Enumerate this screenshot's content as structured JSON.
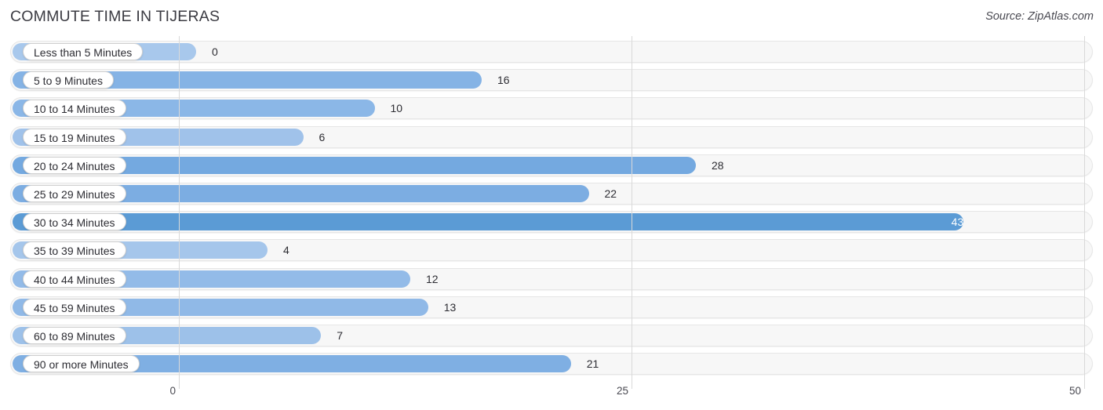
{
  "header": {
    "title": "COMMUTE TIME IN TIJERAS",
    "source": "Source: ZipAtlas.com"
  },
  "colors": {
    "bar_light": "#a8c8ec",
    "bar_mid": "#85b3e5",
    "bar_dark": "#5b9bd5",
    "track": "#f7f7f7",
    "gridline": "#d9d9d9",
    "text": "#2d2d33"
  },
  "chart_data": {
    "type": "bar",
    "orientation": "horizontal",
    "title": "COMMUTE TIME IN TIJERAS",
    "xlabel": "",
    "ylabel": "",
    "xlim": [
      0,
      50
    ],
    "xticks": [
      0,
      25,
      50
    ],
    "xtick_labels": [
      "0",
      "25",
      "50"
    ],
    "grid": true,
    "legend": null,
    "categories": [
      "Less than 5 Minutes",
      "5 to 9 Minutes",
      "10 to 14 Minutes",
      "15 to 19 Minutes",
      "20 to 24 Minutes",
      "25 to 29 Minutes",
      "30 to 34 Minutes",
      "35 to 39 Minutes",
      "40 to 44 Minutes",
      "45 to 59 Minutes",
      "60 to 89 Minutes",
      "90 or more Minutes"
    ],
    "values": [
      0,
      16,
      10,
      6,
      28,
      22,
      43,
      4,
      12,
      13,
      7,
      21
    ],
    "value_labels": [
      "0",
      "16",
      "10",
      "6",
      "28",
      "22",
      "43",
      "4",
      "12",
      "13",
      "7",
      "21"
    ],
    "bar_colors": [
      "#a8c8ec",
      "#85b3e5",
      "#8bb7e7",
      "#a0c2ea",
      "#74a9e0",
      "#7cade2",
      "#5b9bd5",
      "#a5c6eb",
      "#93bbe8",
      "#90b9e7",
      "#9dc1e9",
      "#7fafe3"
    ],
    "label_inside": [
      false,
      false,
      false,
      false,
      false,
      false,
      true,
      false,
      false,
      false,
      false,
      false
    ]
  }
}
